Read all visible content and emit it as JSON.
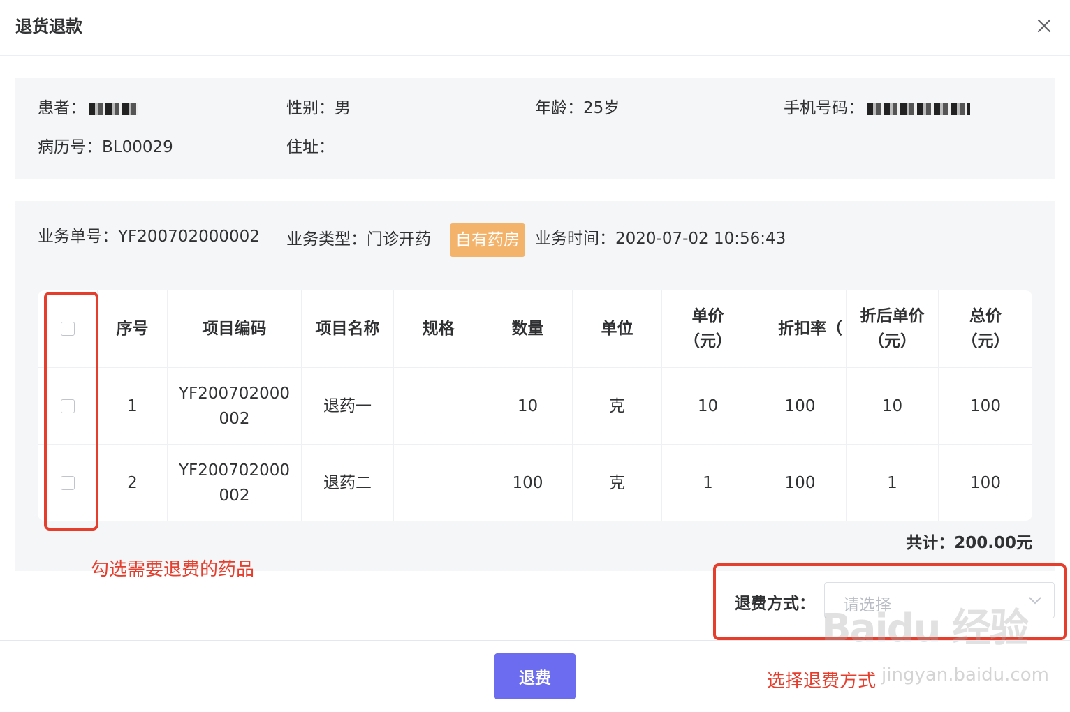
{
  "dialog": {
    "title": "退货退款",
    "close_icon": "close-icon"
  },
  "patient": {
    "name_label": "患者：",
    "gender": "性别：男",
    "age": "年龄：25岁",
    "phone_label": "手机号码：",
    "record": "病历号：BL00029",
    "address": "住址："
  },
  "business": {
    "order_no": "业务单号：YF200702000002",
    "type": "业务类型：门诊开药",
    "tag": "自有药房",
    "time": "业务时间：2020-07-02 10:56:43"
  },
  "table": {
    "columns": [
      "序号",
      "项目编码",
      "项目名称",
      "规格",
      "数量",
      "单位",
      "单价（元）",
      "折扣率（%）",
      "折后单价（元）",
      "总价（元）"
    ],
    "headers": {
      "seq": "序号",
      "code": "项目编码",
      "name": "项目名称",
      "spec": "规格",
      "qty": "数量",
      "unit": "单位",
      "price_1": "单价",
      "price_2": "（元）",
      "discount": "折扣率（",
      "after_1": "折后单价",
      "after_2": "（元）",
      "total_1": "总价",
      "total_2": "（元）"
    },
    "rows": [
      {
        "seq": "1",
        "code_1": "YF200702000",
        "code_2": "002",
        "name": "退药一",
        "spec": "",
        "qty": "10",
        "unit": "克",
        "price": "10",
        "discount": "100",
        "after": "10",
        "total": "100"
      },
      {
        "seq": "2",
        "code_1": "YF200702000",
        "code_2": "002",
        "name": "退药二",
        "spec": "",
        "qty": "100",
        "unit": "克",
        "price": "1",
        "discount": "100",
        "after": "1",
        "total": "100"
      }
    ]
  },
  "total": "共计：200.00元",
  "refund": {
    "label": "退费方式：",
    "placeholder": "请选择"
  },
  "submit_label": "退费",
  "annotations": {
    "select_items": "勾选需要退费的药品",
    "select_method": "选择退费方式"
  },
  "watermark": {
    "logo": "Baidu 经验",
    "url": "jingyan.baidu.com"
  },
  "colors": {
    "primary_button": "#6c6cf0",
    "tag_bg": "#f4b36b",
    "annotation_red": "#e53e2d",
    "panel_bg": "#f5f6f8"
  }
}
